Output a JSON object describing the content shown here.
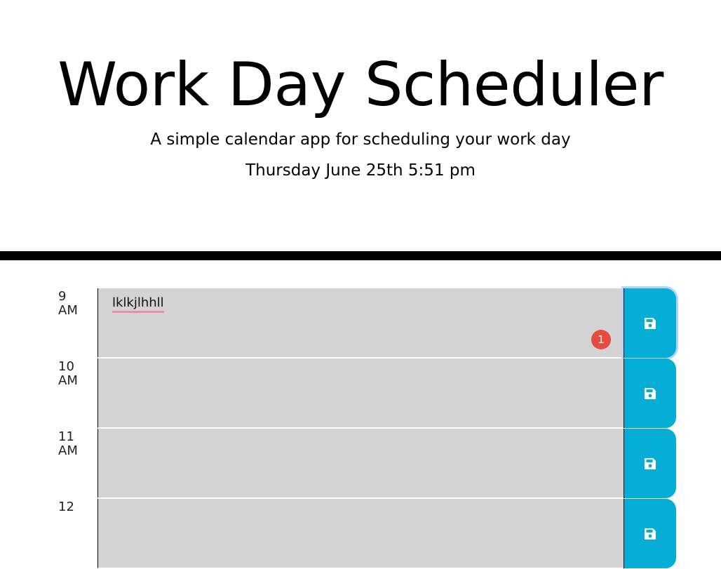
{
  "header": {
    "title": "Work Day Scheduler",
    "subtitle": "A simple calendar app for scheduling your work day",
    "current_day": "Thursday June 25th 5:51 pm"
  },
  "time_blocks": [
    {
      "hour_top": "9",
      "hour_bottom": "AM",
      "text": "lklkjlhhll",
      "badge": "1",
      "save_icon": "save-icon"
    },
    {
      "hour_top": "10",
      "hour_bottom": "AM",
      "text": "",
      "save_icon": "save-icon"
    },
    {
      "hour_top": "11",
      "hour_bottom": "AM",
      "text": "",
      "save_icon": "save-icon"
    },
    {
      "hour_top": "12",
      "hour_bottom": "",
      "text": "",
      "save_icon": "save-icon"
    }
  ],
  "colors": {
    "block_background": "#d3d3d3",
    "save_button": "#06aed5",
    "badge": "#e54b3f",
    "divider": "#000000"
  }
}
